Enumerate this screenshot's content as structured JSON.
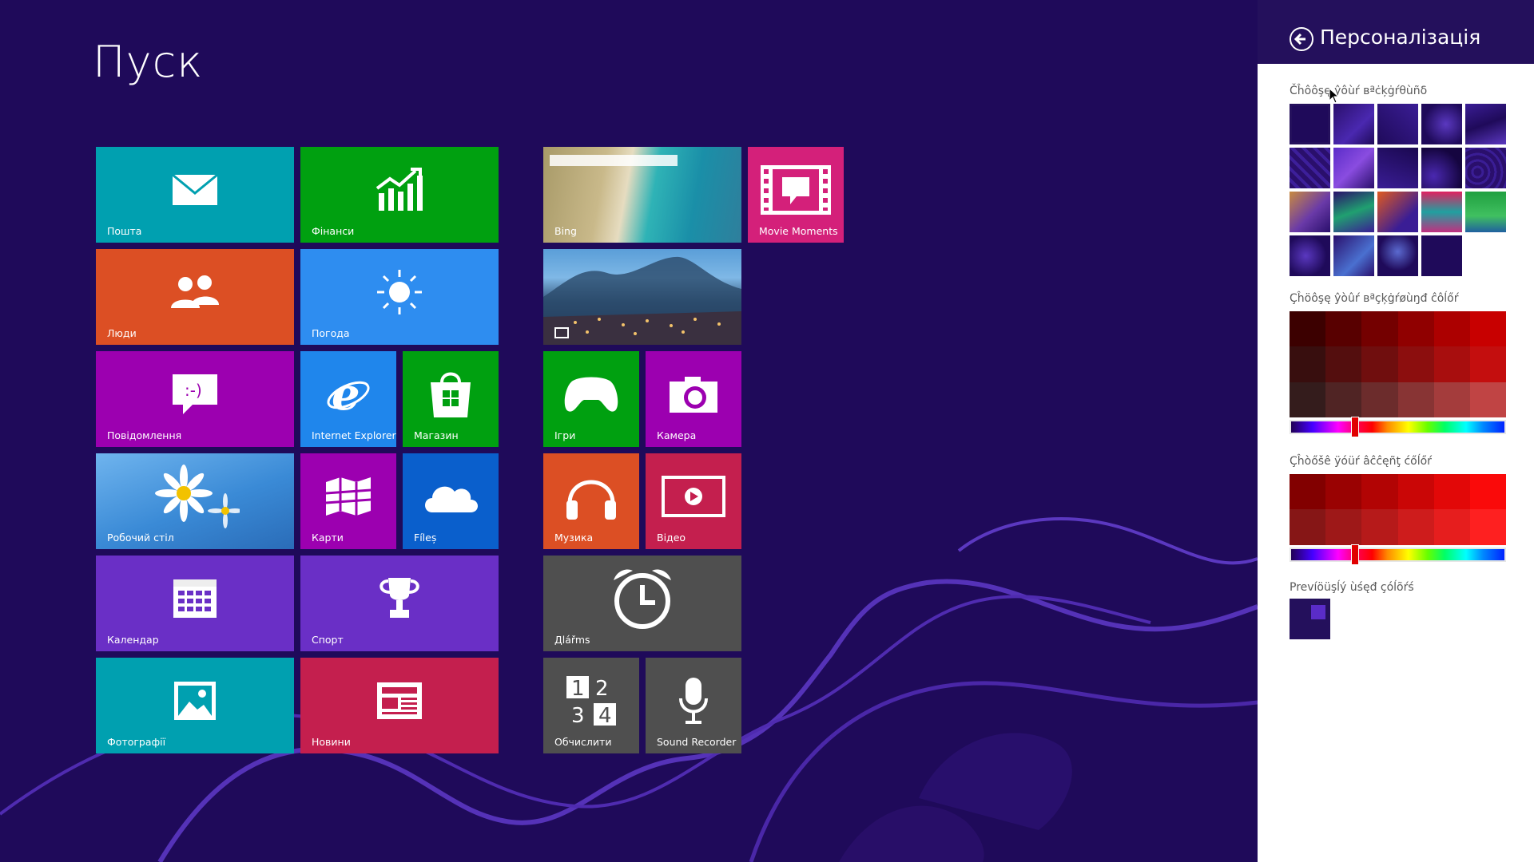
{
  "start": {
    "title": "Пуск"
  },
  "tiles": {
    "mail": "Пошта",
    "finance": "Фінанси",
    "bing": "Bing",
    "movie_moments": "Movie Moments",
    "people": "Люди",
    "weather": "Погода",
    "messaging": "Повідомлення",
    "ie": "Internet Explorer",
    "store": "Магазин",
    "games": "Ігри",
    "camera": "Камера",
    "desktop": "Робочий стіл",
    "maps": "Карти",
    "files": "Fíleș",
    "music": "Музика",
    "video": "Відео",
    "calendar": "Календар",
    "sport": "Спорт",
    "alarms": "Дlářms",
    "photos": "Фотографії",
    "news": "Новини",
    "calculator": "Обчислити",
    "sound_recorder": "Sound Recorder"
  },
  "pane": {
    "title": "Персоналізація",
    "bg_label": "Čĥôôşę ŷôùŕ вªċķġŕθùñδ",
    "bg_color_label": "Çĥöôşę ŷòûŕ вªçķġŕøùŋđ ĉôĺőŕ",
    "accent_label": "Çĥòőšê ÿóüŕ âĉĉęñţ ćőĺőŕ",
    "prev_label": "Prevíöüşĺý ùśęđ çóĺõŕś"
  },
  "colors": {
    "background": "#1f0a5a",
    "pane_header": "#24105c",
    "accent": "#e00000"
  },
  "icons": {
    "mail": "envelope-icon",
    "finance": "chart-up-icon",
    "people": "people-icon",
    "weather": "sun-icon",
    "messaging": "chat-icon",
    "ie": "ie-logo-icon",
    "store": "store-bag-icon",
    "games": "gamepad-icon",
    "camera": "camera-icon",
    "maps": "map-icon",
    "files": "cloud-icon",
    "music": "headphones-icon",
    "video": "play-icon",
    "calendar": "calendar-icon",
    "sport": "trophy-icon",
    "alarms": "alarm-clock-icon",
    "photos": "photo-icon",
    "news": "newspaper-icon",
    "calculator": "numbers-icon",
    "sound_recorder": "microphone-icon",
    "back": "back-arrow-icon"
  }
}
